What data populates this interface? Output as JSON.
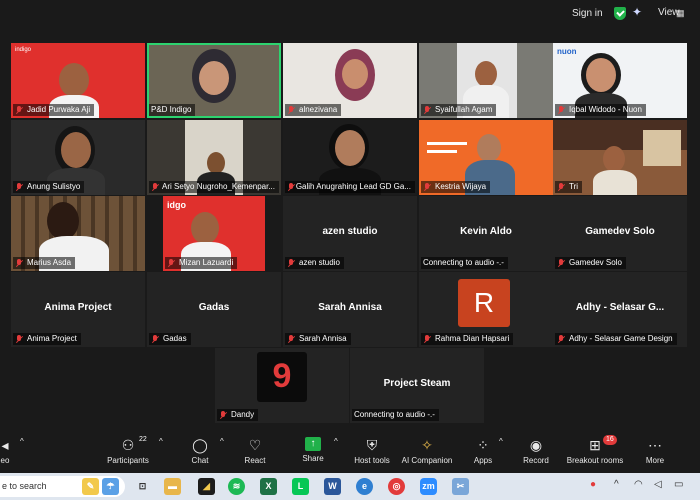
{
  "topbar": {
    "signin_label": "Sign in",
    "view_label": "View"
  },
  "participants": [
    {
      "name": "Jadid Purwaka Aji",
      "muted": true
    },
    {
      "name": "P&D Indigo",
      "muted": false
    },
    {
      "name": "alnezivana",
      "muted": true
    },
    {
      "name": "Syaifullah Agam",
      "muted": true
    },
    {
      "name": "Iqbal Widodo - Nuon",
      "muted": true
    },
    {
      "name": "Anung Sulistyo",
      "muted": true
    },
    {
      "name": "Ari Setyo Nugroho_Kemenpar...",
      "muted": true
    },
    {
      "name": "Galih Anugrahing Lead GD Ga...",
      "muted": true
    },
    {
      "name": "Kestria Wijaya",
      "muted": true
    },
    {
      "name": "Tri",
      "muted": true
    },
    {
      "name": "Marius Asda",
      "muted": true
    },
    {
      "name": "Mizan Lazuardi",
      "muted": true
    },
    {
      "name": "azen studio",
      "title": "azen studio",
      "muted": true
    },
    {
      "name": "Connecting to audio -.-",
      "title": "Kevin Aldo",
      "muted": false
    },
    {
      "name": "Gamedev Solo",
      "title": "Gamedev Solo",
      "muted": true
    },
    {
      "name": "Anima Project",
      "title": "Anima Project",
      "muted": true
    },
    {
      "name": "Gadas",
      "title": "Gadas",
      "muted": true
    },
    {
      "name": "Sarah Annisa",
      "title": "Sarah Annisa",
      "muted": true
    },
    {
      "name": "Rahma Dian Hapsari",
      "avatar_letter": "R",
      "muted": true
    },
    {
      "name": "Adhy - Selasar Game Design",
      "title": "Adhy - Selasar G...",
      "muted": true
    },
    {
      "name": "Dandy",
      "muted": true
    },
    {
      "name": "Connecting to audio -.-",
      "title": "Project Steam",
      "muted": false
    }
  ],
  "toolbar": {
    "video_label": "eo",
    "participants_label": "Participants",
    "participants_count": "22",
    "chat_label": "Chat",
    "react_label": "React",
    "share_label": "Share",
    "host_tools_label": "Host tools",
    "ai_companion_label": "AI Companion",
    "apps_label": "Apps",
    "record_label": "Record",
    "breakout_label": "Breakout rooms",
    "breakout_badge": "16",
    "more_label": "More"
  },
  "taskbar": {
    "search_placeholder": "e to search"
  },
  "colors": {
    "accent_green": "#21b14a",
    "active_speaker": "#2dd36f",
    "muted_red": "#e23b3b"
  }
}
